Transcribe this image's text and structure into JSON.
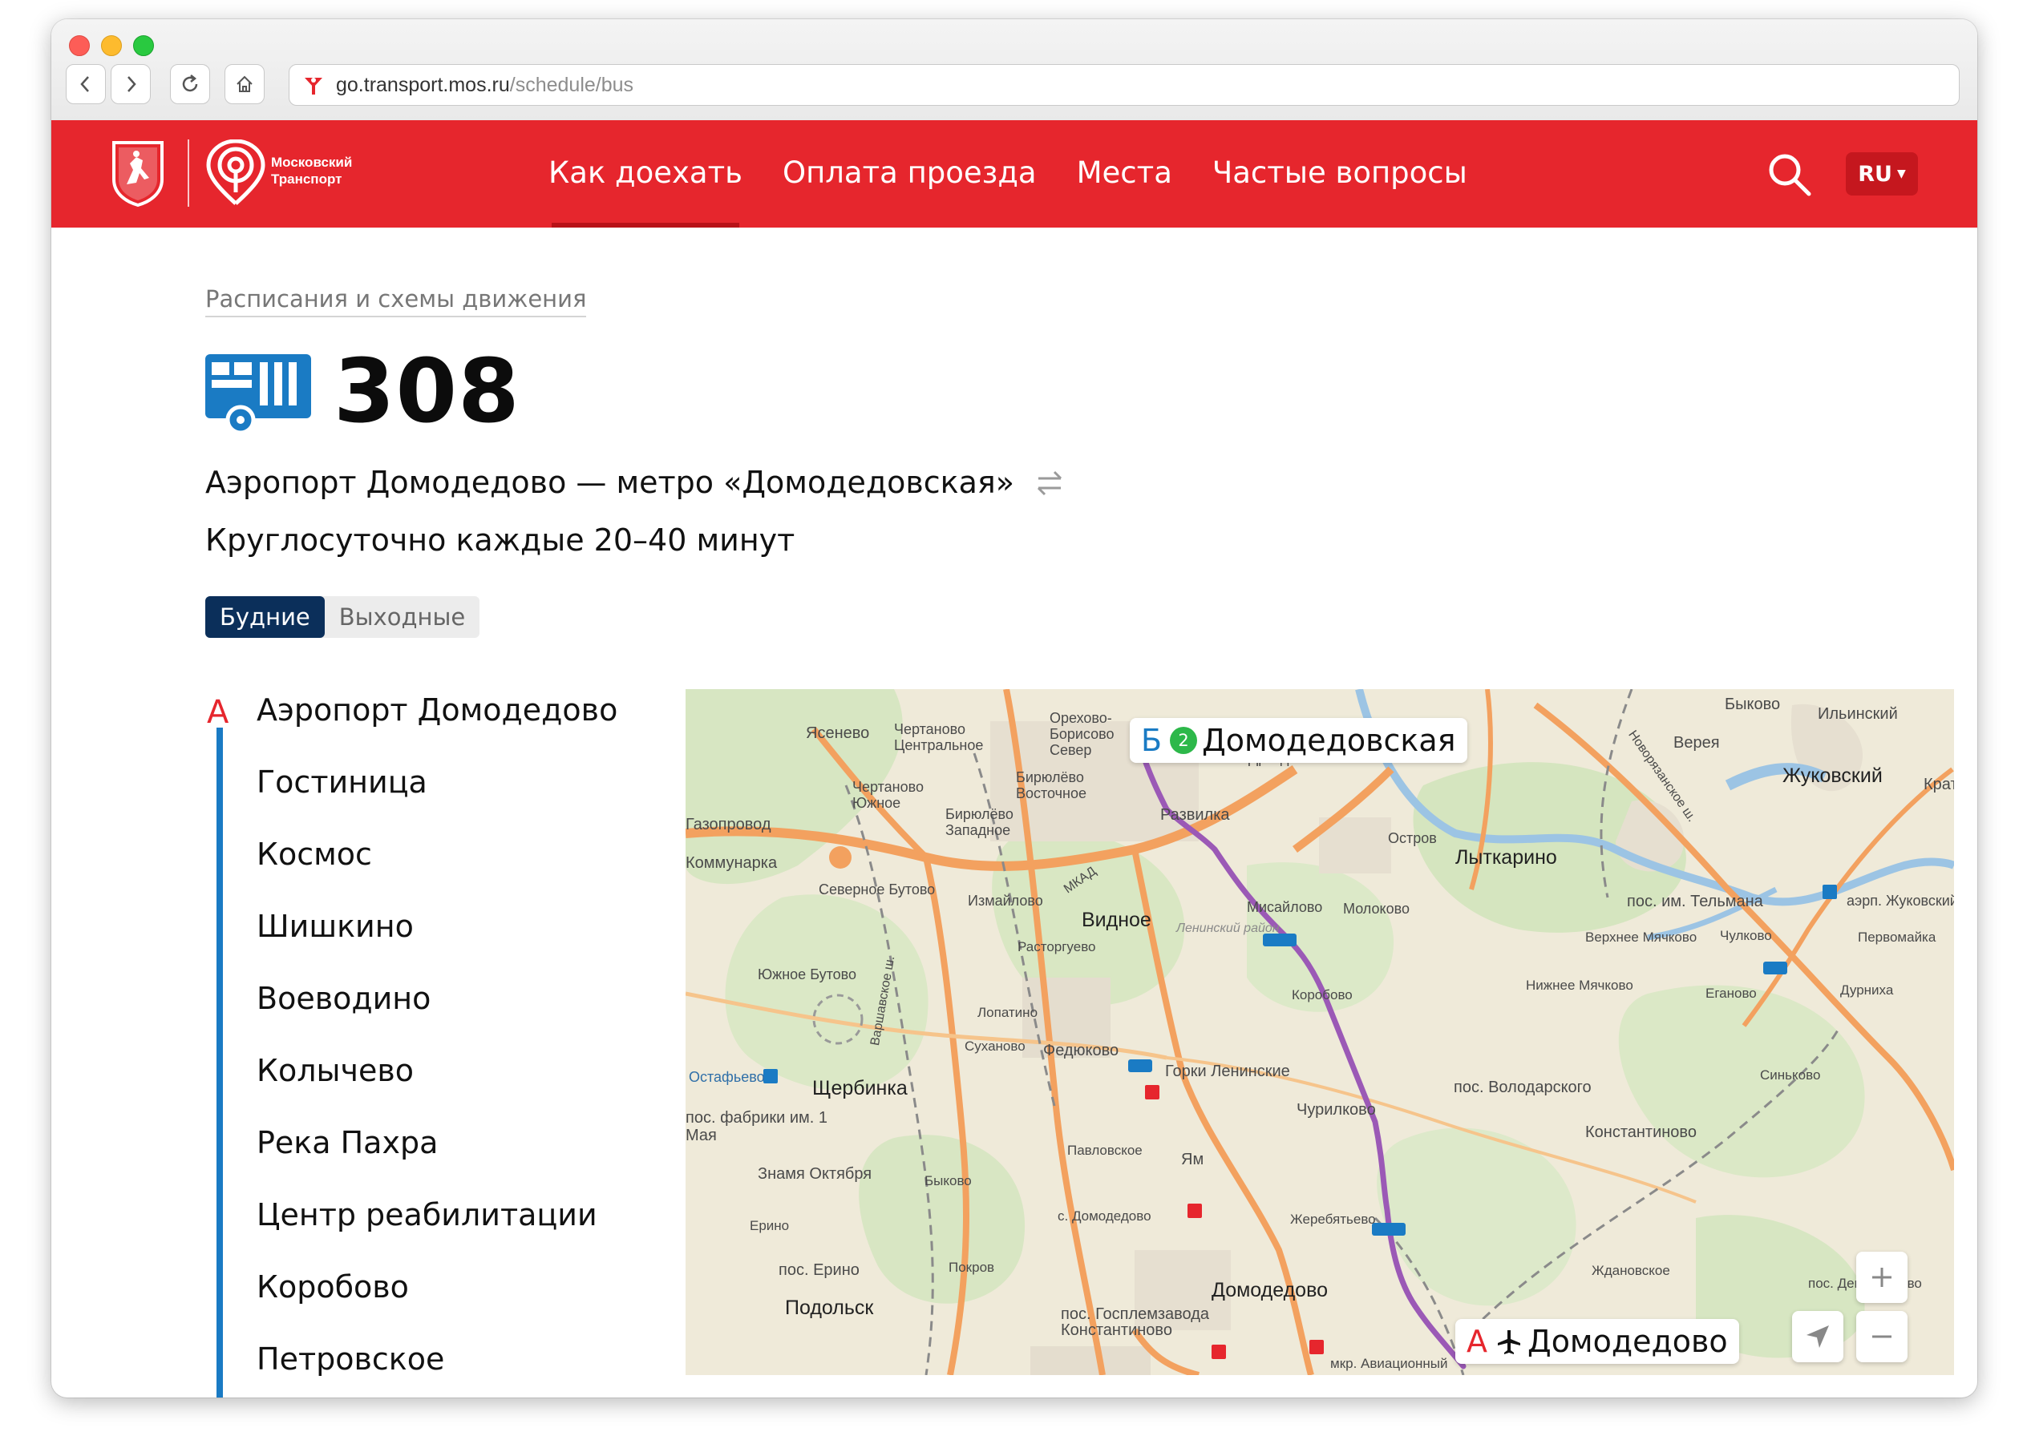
{
  "browser": {
    "url_host": "go.transport.mos.ru",
    "url_path": "/schedule/bus"
  },
  "header": {
    "brand_line1": "Московский",
    "brand_line2": "Транспорт",
    "nav": [
      {
        "label": "Как доехать",
        "active": true
      },
      {
        "label": "Оплата проезда",
        "active": false
      },
      {
        "label": "Места",
        "active": false
      },
      {
        "label": "Частые вопросы",
        "active": false
      }
    ],
    "lang": "RU",
    "accent_color": "#e6262d"
  },
  "page": {
    "breadcrumb": "Расписания и схемы движения",
    "route_number": "308",
    "route_name": "Аэропорт Домодедово — метро «Домодедовская»",
    "frequency": "Круглосуточно каждые 20–40 минут",
    "tabs": [
      {
        "label": "Будние",
        "active": true
      },
      {
        "label": "Выходные",
        "active": false
      }
    ]
  },
  "stops": {
    "start_letter": "А",
    "items": [
      "Аэропорт Домодедово",
      "Гостиница",
      "Космос",
      "Шишкино",
      "Воеводино",
      "Колычево",
      "Река Пахра",
      "Центр реабилитации",
      "Коробово",
      "Петровское"
    ],
    "line_color": "#1a7bc4"
  },
  "map": {
    "end_letter": "Б",
    "end_metro_line": "2",
    "end_name": "Домодедовская",
    "start_letter": "А",
    "start_name": "Домодедово",
    "route_color": "#9b59b6",
    "labels": [
      "Быково",
      "Ильинский",
      "Верея",
      "Жуковский",
      "Крат",
      "Чертаново Центральное",
      "Ясенево",
      "Орехово-Борисово Север",
      "Дроздóво",
      "Бирюлёво Восточное",
      "Чертаново Южное",
      "Бирюлёво Западное",
      "Развилка",
      "Остров",
      "Лыткарино",
      "МКАД",
      "Северное Бутово",
      "Измайлово",
      "Видное",
      "Мисайлово",
      "Молоково",
      "пос. им. Тельмана",
      "аэрп. Жуковский",
      "Верхнее Мячково",
      "Чулково",
      "Первомайка",
      "Ленинский район",
      "Расторгуево",
      "Южное Бутово",
      "Коробово",
      "Нижнее Мячково",
      "Еганово",
      "Дурниха",
      "Лопатино",
      "Суханово",
      "Федюково",
      "Горки Ленинские",
      "Остафьево",
      "Щербинка",
      "пос. Володарского",
      "Синьково",
      "пос. фабрики им. 1 Мая",
      "Чурилково",
      "Константиново",
      "Павловское",
      "Ям",
      "Знамя Октября",
      "Быково",
      "Ерино",
      "с. Домодедово",
      "Жеребятьево",
      "пос. Ерино",
      "Покров",
      "Ждановское",
      "пос. Денежниково",
      "Подольск",
      "Домодедово",
      "пос. Госплемзавода Константиново",
      "мкр. Авиационный",
      "Газопровод",
      "Коммунарка",
      "Варшавское ш.",
      "Новорязанское ш."
    ]
  }
}
